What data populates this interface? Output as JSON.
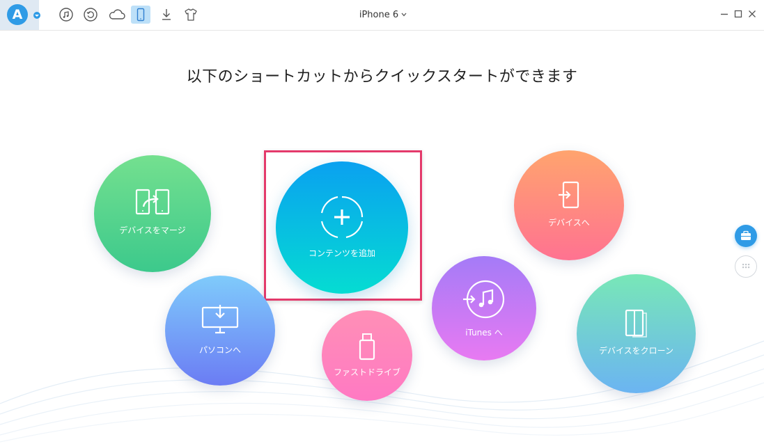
{
  "toolbar": {
    "logo_letter": "A",
    "device_name": "iPhone 6",
    "tools": [
      "music-icon",
      "restore-icon",
      "cloud-icon",
      "device-icon",
      "download-icon",
      "tshirt-icon"
    ]
  },
  "main": {
    "headline": "以下のショートカットからクイックスタートができます",
    "shortcuts": {
      "merge_device": "デバイスをマージ",
      "add_content": "コンテンツを追加",
      "to_device": "デバイスへ",
      "to_pc": "パソコンへ",
      "fast_drive": "ファストドライブ",
      "to_itunes": "iTunes へ",
      "clone_device": "デバイスをクローン"
    }
  },
  "colors": {
    "accent": "#2f9be6",
    "highlight_border": "#e43a6b"
  }
}
